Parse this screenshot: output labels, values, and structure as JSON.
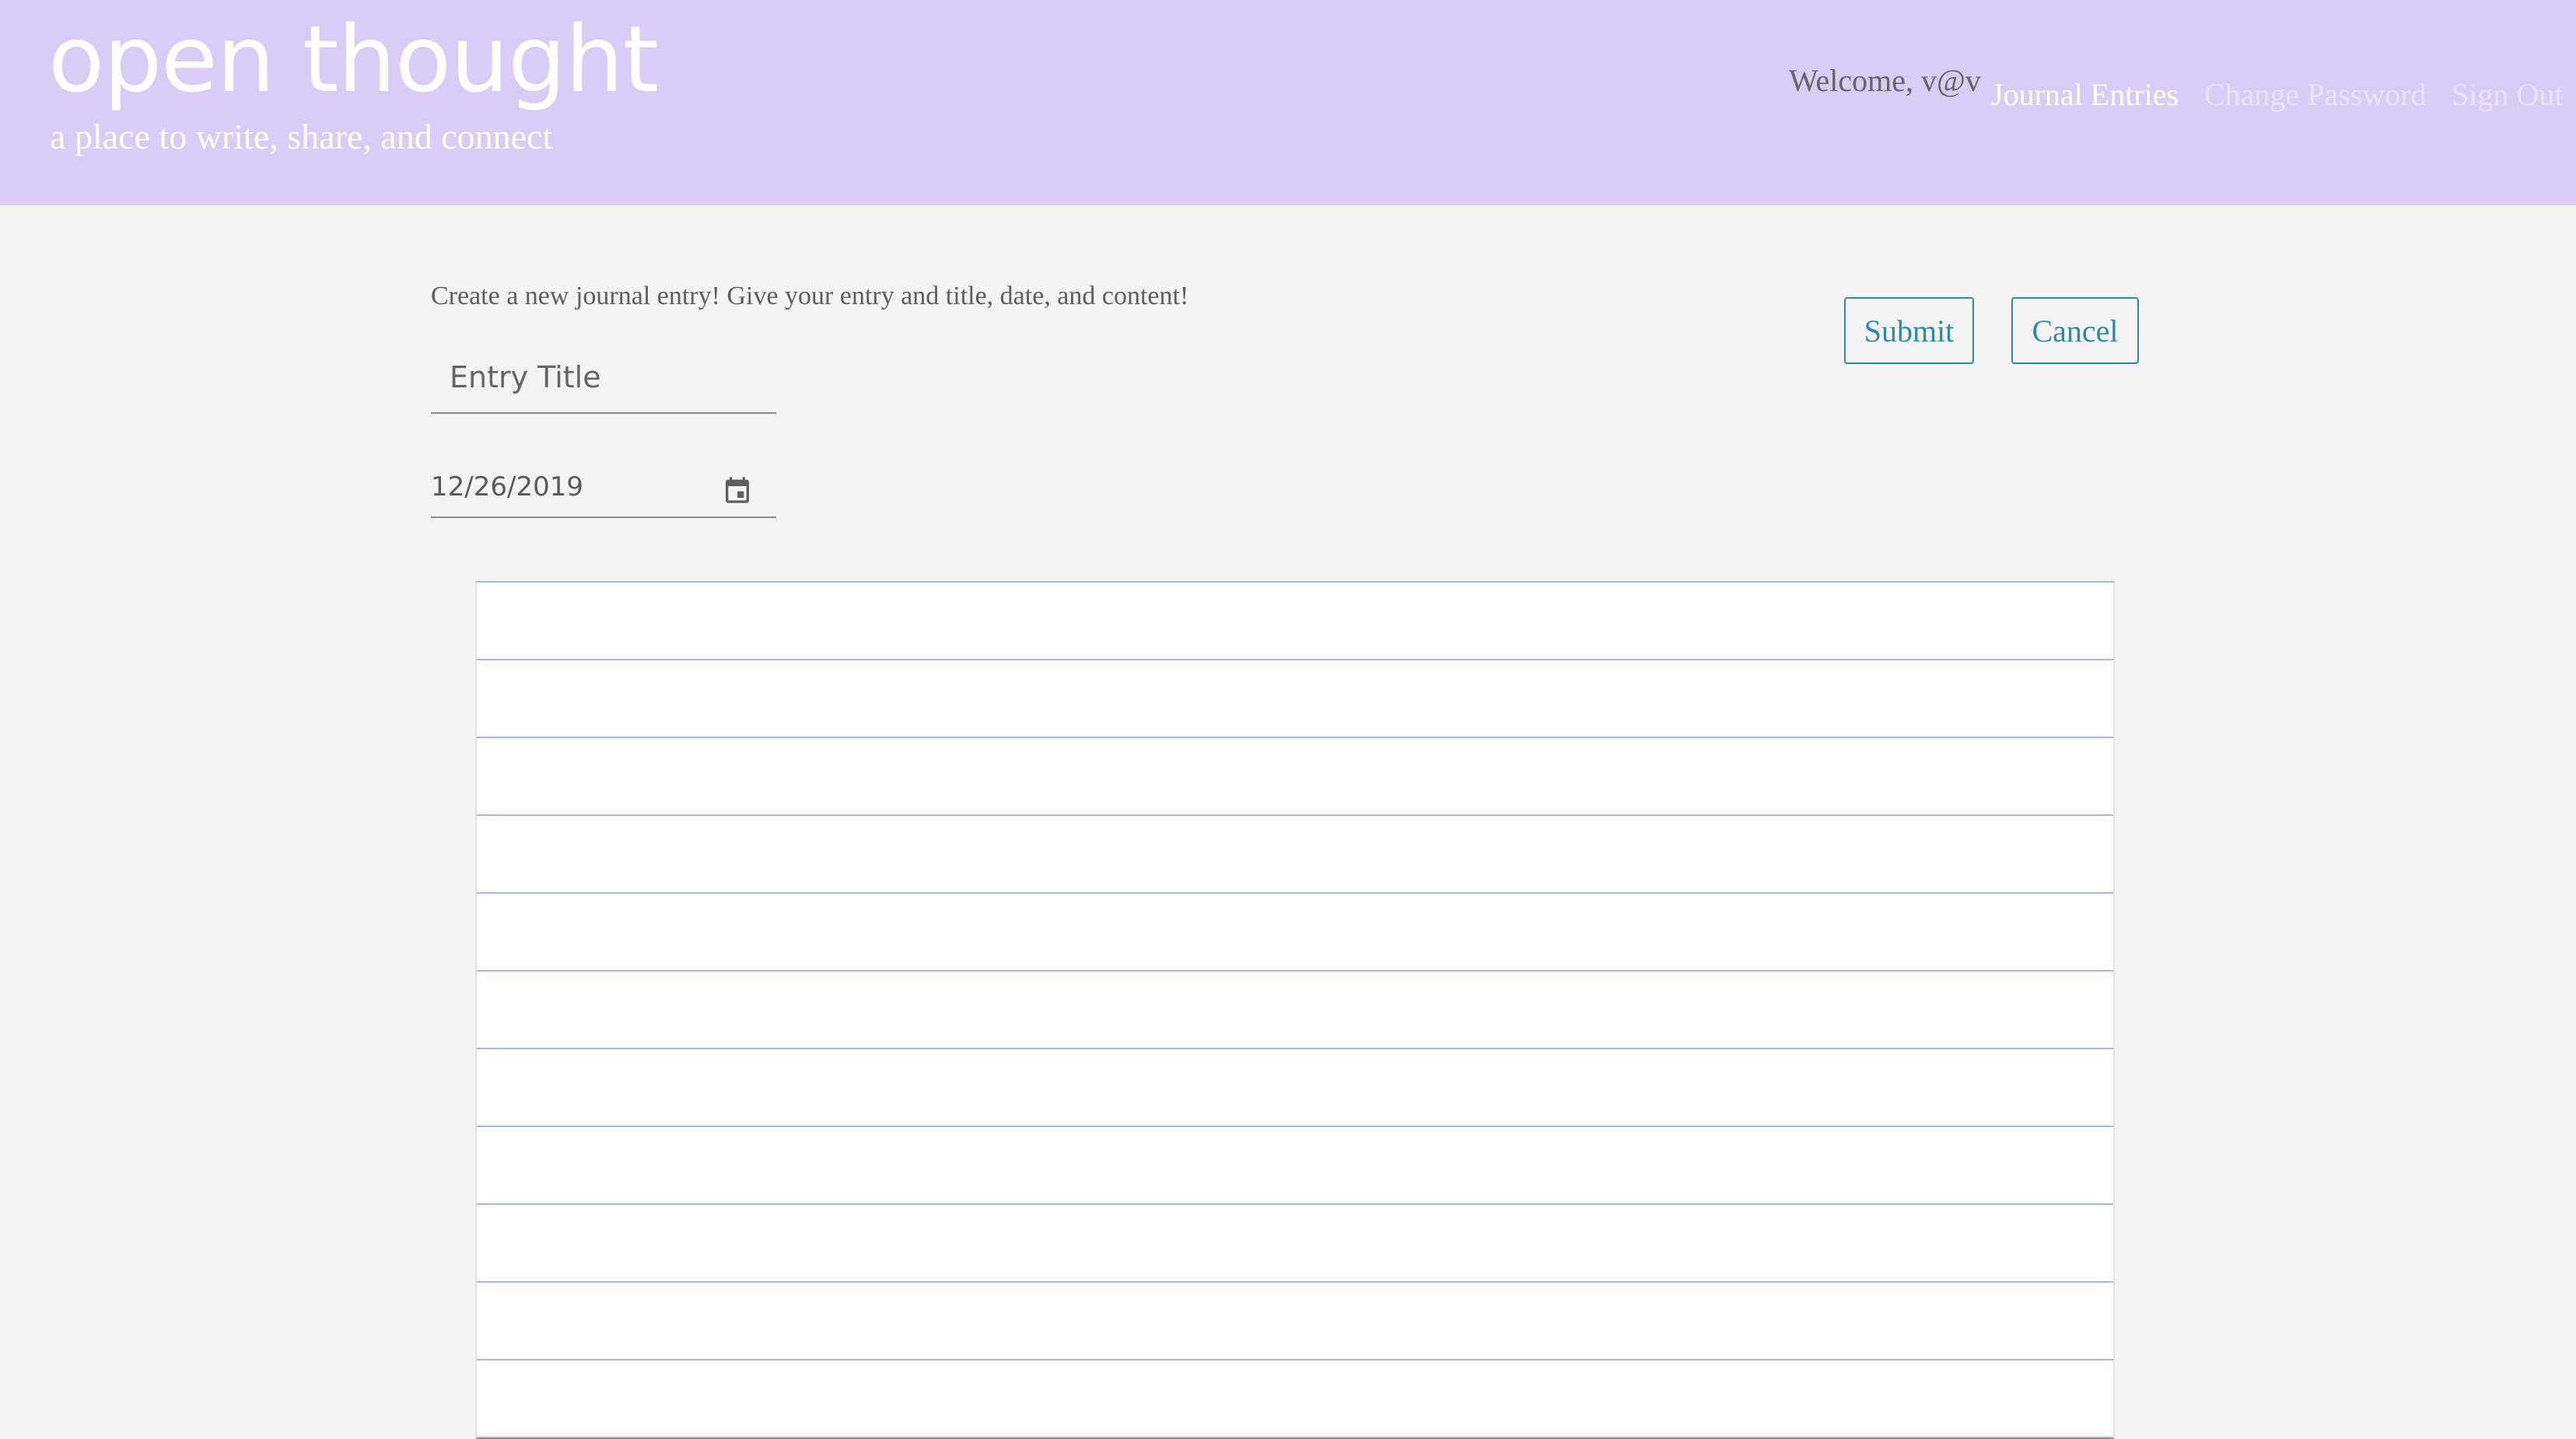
{
  "header": {
    "brand_title": "open thought",
    "tagline": "a place to write, share, and connect",
    "welcome_text": "Welcome, v@v",
    "nav": {
      "journal_entries": "Journal Entries",
      "change_password": "Change Password",
      "sign_out": "Sign Out"
    },
    "background_color": "#d9ccf7"
  },
  "form": {
    "instructions": "Create a new journal entry! Give your entry and title, date, and content!",
    "title_placeholder": "Entry Title",
    "title_value": "",
    "date_value": "12/26/2019",
    "date_icon": "calendar-icon",
    "content_value": "",
    "submit_label": "Submit",
    "cancel_label": "Cancel",
    "accent_color": "#2d8aa3",
    "paper_line_color": "#a9b9e6"
  }
}
